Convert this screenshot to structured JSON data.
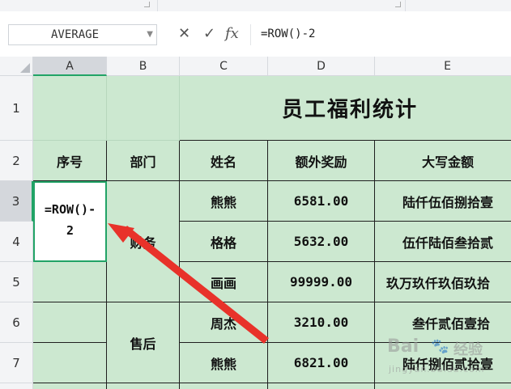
{
  "formula_bar": {
    "name_box": "AVERAGE",
    "cancel_icon": "✕",
    "enter_icon": "✓",
    "fx_label": "fx",
    "formula": "=ROW()-2"
  },
  "columns": [
    "A",
    "B",
    "C",
    "D",
    "E"
  ],
  "rows": [
    "1",
    "2",
    "3",
    "4",
    "5",
    "6",
    "7"
  ],
  "sheet": {
    "title": "员工福利统计",
    "headers": {
      "seq": "序号",
      "dept": "部门",
      "name": "姓名",
      "bonus": "额外奖励",
      "amount_words": "大写金额"
    },
    "editing_cell": {
      "line1": "=ROW()-",
      "line2": "2"
    },
    "departments": [
      "财务",
      "售后"
    ],
    "records": [
      {
        "name": "熊熊",
        "bonus": "6581.00",
        "words": "陆仟伍佰捌拾壹"
      },
      {
        "name": "格格",
        "bonus": "5632.00",
        "words": "伍仟陆佰叁拾贰"
      },
      {
        "name": "画画",
        "bonus": "99999.00",
        "words": "玖万玖仟玖佰玖拾"
      },
      {
        "name": "周杰",
        "bonus": "3210.00",
        "words": "叁仟贰佰壹拾"
      },
      {
        "name": "熊熊",
        "bonus": "6821.00",
        "words": "陆仟捌佰贰拾壹"
      }
    ]
  },
  "colors": {
    "cell_fill": "#cce8d0",
    "selection": "#21a366",
    "arrow": "#e8322a"
  },
  "watermark": {
    "brand": "Bai",
    "paw": "🐾",
    "cn": "经验",
    "url": "jingyan.baidu.com"
  }
}
